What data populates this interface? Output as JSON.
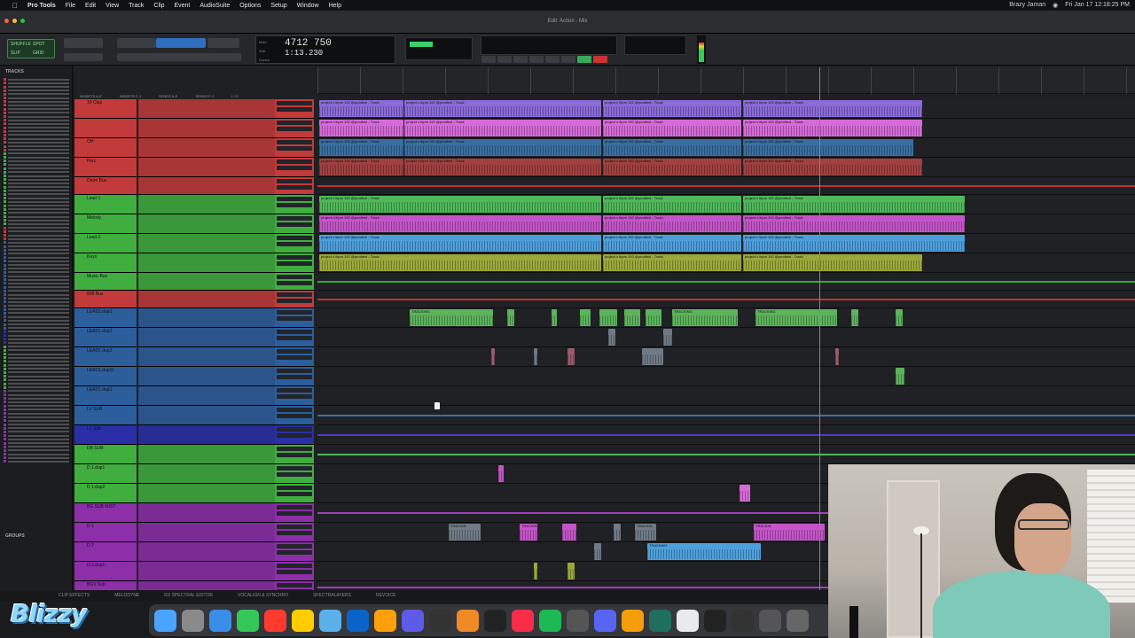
{
  "menubar": {
    "app": "Pro Tools",
    "items": [
      "File",
      "Edit",
      "View",
      "Track",
      "Clip",
      "Event",
      "AudioSuite",
      "Options",
      "Setup",
      "Window",
      "Help"
    ],
    "status_user": "Brazy Jaman",
    "clock": "Fri Jan 17 12:18:25 PM"
  },
  "window": {
    "title": "Edit: Action - Mix"
  },
  "toolbar": {
    "counter_main": "4712 750",
    "counter_sub": "1:13.230",
    "counter_labels": [
      "Main",
      "Sub",
      "Cursor"
    ],
    "mode_labels": [
      "SHUFFLE",
      "SPOT",
      "SLIP",
      "GRID"
    ]
  },
  "sidebar": {
    "header": "TRACKS",
    "groups_header": "GROUPS"
  },
  "columns": {
    "labels": [
      "INSERTS A-E",
      "INSERTS F-J",
      "SENDS A-E",
      "SENDS F-J",
      "I / O"
    ]
  },
  "tracks": [
    {
      "id": "clap",
      "label": "18 Clap",
      "color": "#c23a3a"
    },
    {
      "id": "hh",
      "label": "",
      "color": "#c23a3a"
    },
    {
      "id": "oh",
      "label": "OH",
      "color": "#c23a3a"
    },
    {
      "id": "perc",
      "label": "Perc",
      "color": "#c23a3a"
    },
    {
      "id": "drum-bus",
      "label": "Drum Bus",
      "color": "#c23a3a"
    },
    {
      "id": "lead1",
      "label": "Lead 1",
      "color": "#3fae3f"
    },
    {
      "id": "melody",
      "label": "Melody",
      "color": "#3fae3f"
    },
    {
      "id": "lead2",
      "label": "Lead 2",
      "color": "#3fae3f"
    },
    {
      "id": "keys",
      "label": "Keys",
      "color": "#3fae3f"
    },
    {
      "id": "music-bus",
      "label": "Music Bus",
      "color": "#3fae3f"
    },
    {
      "id": "808-bus",
      "label": "808 Bus",
      "color": "#c23a3a"
    },
    {
      "id": "lead01",
      "label": "LEAD1.dup1",
      "color": "#2c5e9c"
    },
    {
      "id": "lead02",
      "label": "LEAD1.dup2",
      "color": "#2c5e9c"
    },
    {
      "id": "lead03",
      "label": "LEAD1.dup3",
      "color": "#2c5e9c"
    },
    {
      "id": "lead04",
      "label": "LEAD1.dup11",
      "color": "#2c5e9c"
    },
    {
      "id": "lead05",
      "label": "LEAD1.dup1",
      "color": "#2c5e9c"
    },
    {
      "id": "lv-sub",
      "label": "LV SUB",
      "color": "#2c5e9c"
    },
    {
      "id": "lv-sub2",
      "label": "LV Sub",
      "color": "#2a2fa8"
    },
    {
      "id": "db-sub",
      "label": "DB SUB",
      "color": "#3fae3f"
    },
    {
      "id": "d1dup1",
      "label": "D 1.dup1",
      "color": "#3fae3f"
    },
    {
      "id": "d1dup2",
      "label": "D 1.dup2",
      "color": "#3fae3f"
    },
    {
      "id": "bg-sub",
      "label": "BG SUB MIST",
      "color": "#8c2fa8"
    },
    {
      "id": "d1",
      "label": "D 1",
      "color": "#8c2fa8"
    },
    {
      "id": "d2",
      "label": "D 2",
      "color": "#8c2fa8"
    },
    {
      "id": "d2dup1",
      "label": "D 2.dup1",
      "color": "#8c2fa8"
    },
    {
      "id": "bgv",
      "label": "BGV Sub",
      "color": "#8c2fa8"
    }
  ],
  "clips": {
    "generic_label": "project x ibpm 192 @prodfeel - Track",
    "tracking": "TRACKING",
    "tracking_short": "TRACKIN"
  },
  "bottom_tabs": [
    "CLIP EFFECTS",
    "MELODYNE",
    "RX SPECTRAL EDITOR",
    "VOCALIGN & SYNCHRO",
    "SPECTRALAYERS",
    "REVOICE"
  ],
  "dock": {
    "icons": [
      "finder-icon",
      "launchpad-icon",
      "safari-icon",
      "messages-icon",
      "calendar-icon",
      "notes-icon",
      "preview-icon",
      "outlook-icon",
      "photos-icon",
      "arc-icon",
      "uvi-icon",
      "fl-icon",
      "piano-icon",
      "music-icon",
      "spotify-icon",
      "quicktime-icon",
      "discord-icon",
      "books-icon",
      "terminal-icon",
      "chrome-icon",
      "capcut-icon",
      "ua-icon",
      "activity-icon",
      "trash-icon"
    ]
  },
  "overlay": {
    "logo": "Blizzy"
  }
}
